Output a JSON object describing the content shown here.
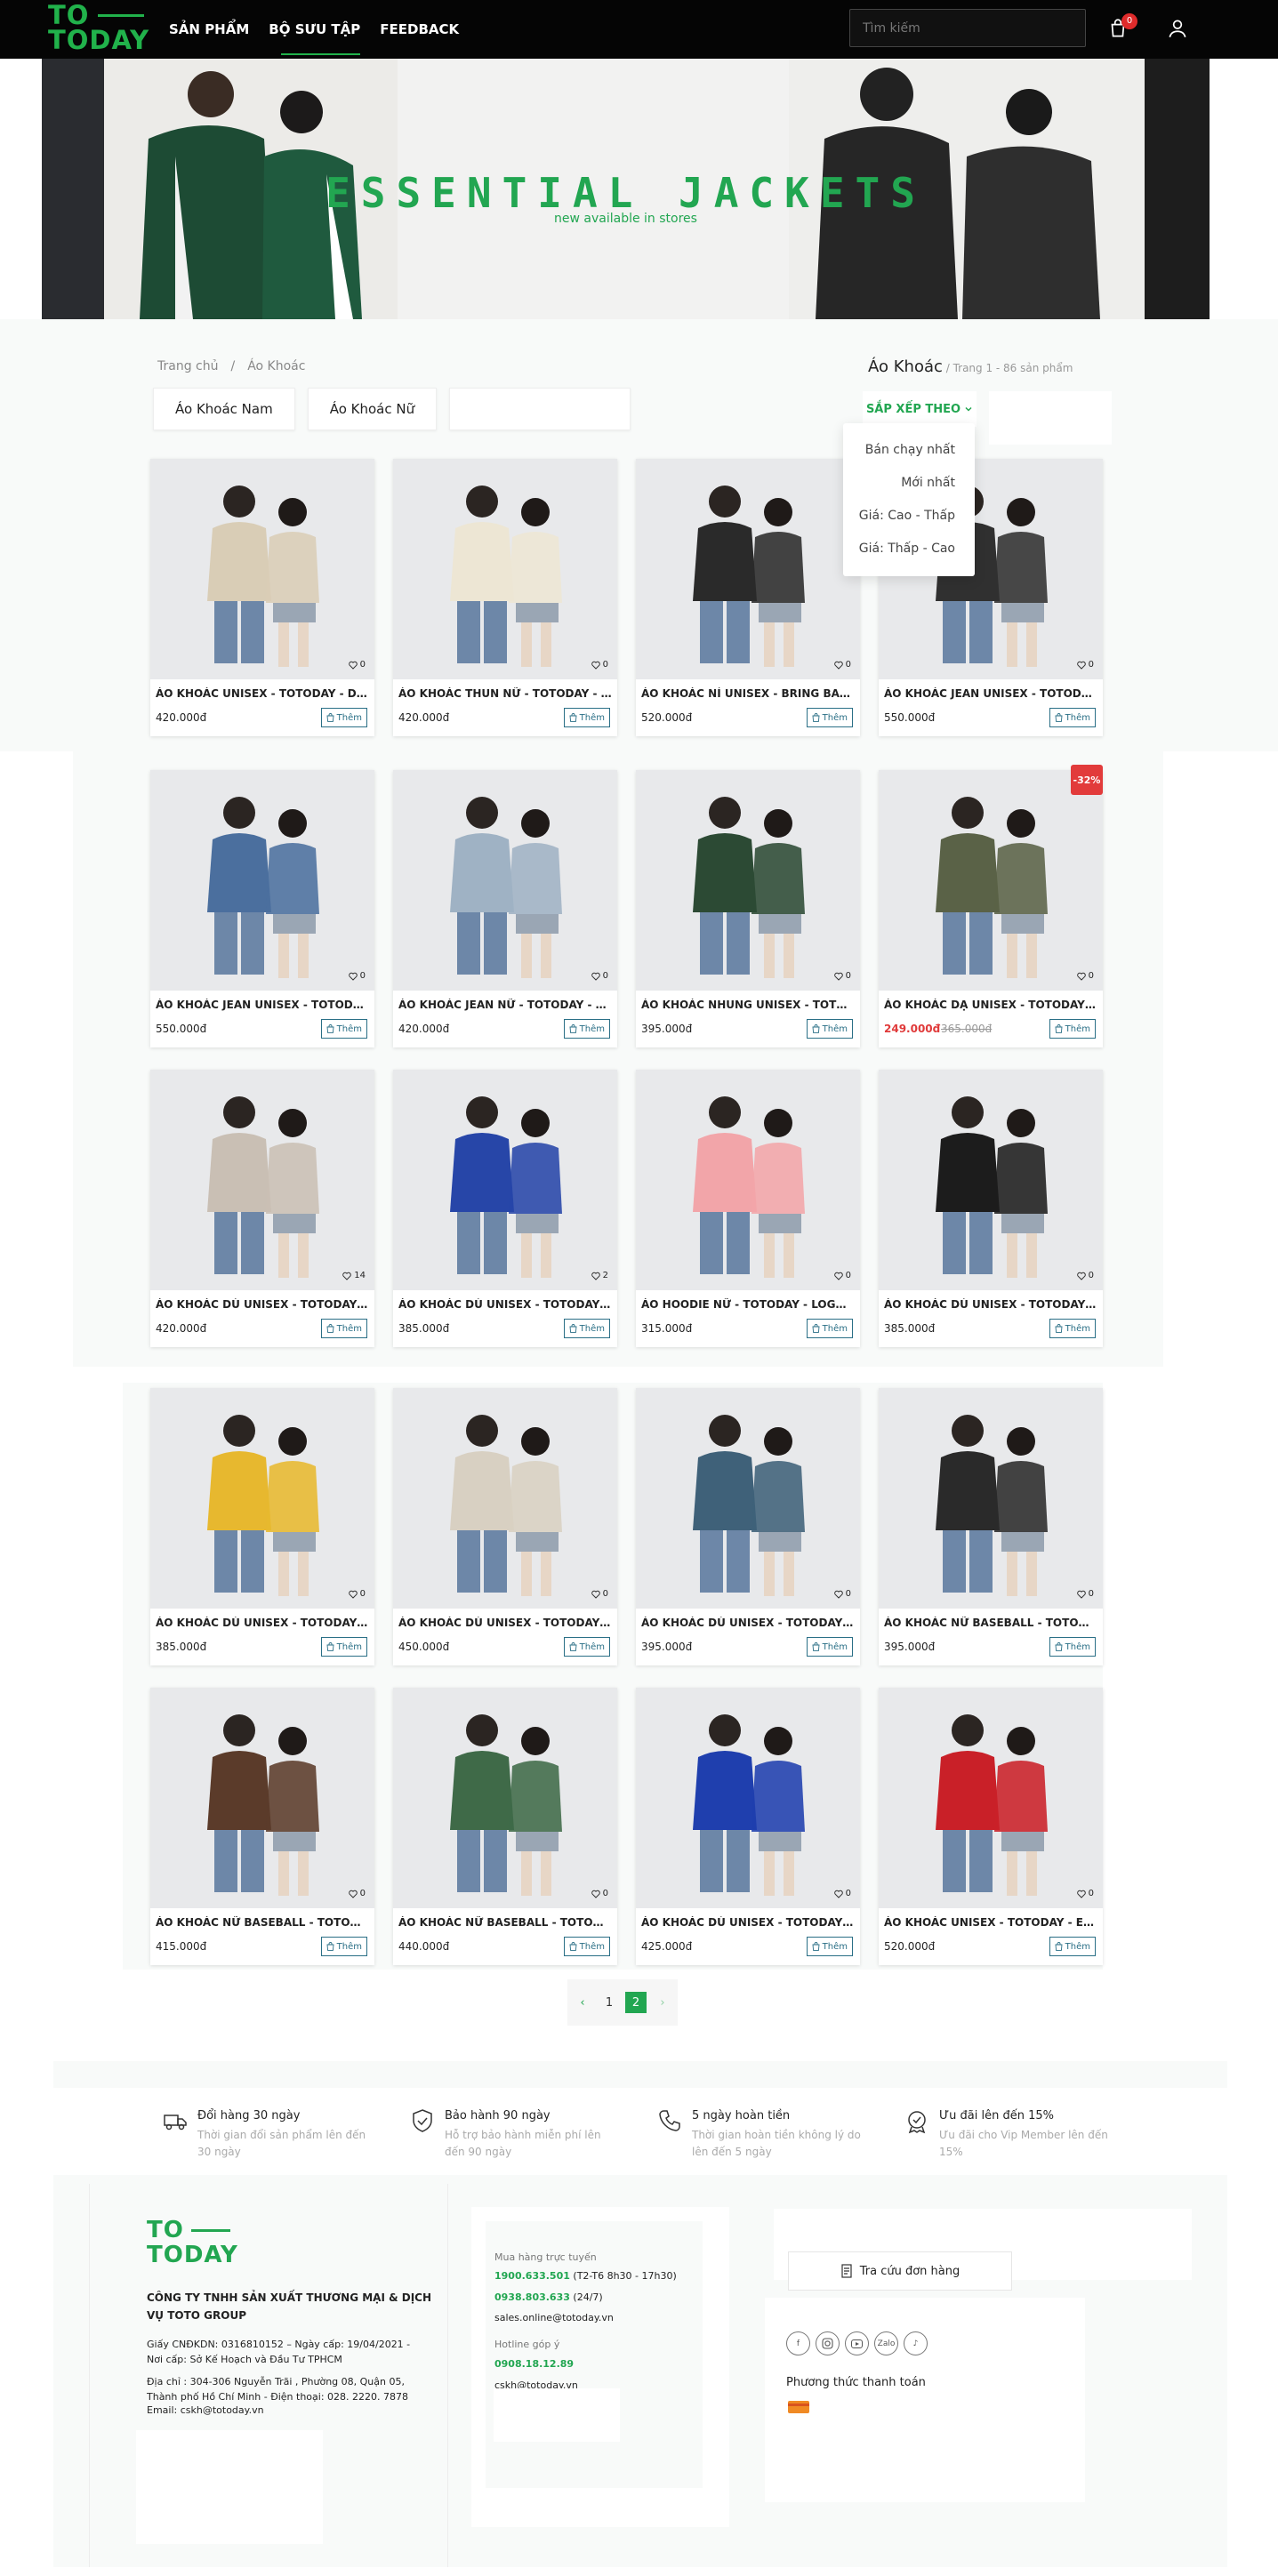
{
  "header": {
    "logo_line1": "TO",
    "logo_line2": "TODAY",
    "nav": [
      "SẢN PHẨM",
      "BỘ SƯU TẬP",
      "FEEDBACK"
    ],
    "search_placeholder": "Tìm kiếm",
    "cart_count": "0",
    "brand_color": "#21b24b"
  },
  "banner": {
    "title": "ESSENTIAL JACKETS",
    "subtitle": "new available in stores"
  },
  "breadcrumb": [
    "Trang chủ",
    "/",
    "Áo Khoác"
  ],
  "category": {
    "title": "Áo Khoác",
    "meta": " / Trang 1 - 86 sản phẩm"
  },
  "filters": [
    "Áo Khoác Nam",
    "Áo Khoác Nữ"
  ],
  "sort": {
    "label": "SẮP XẾP THEO",
    "options": [
      "Bán chạy nhất",
      "Mới nhất",
      "Giá: Cao - Thấp",
      "Giá: Thấp - Cao"
    ]
  },
  "add_label": "Thêm",
  "products": [
    {
      "name": "ÁO KHOÁC UNISEX - TOTODAY - DIFFERENT",
      "price": "420.000đ",
      "likes": "0",
      "color": "#d9cdb6"
    },
    {
      "name": "ÁO KHOÁC THUN NỮ - TOTODAY - DELI",
      "price": "420.000đ",
      "likes": "0",
      "color": "#ede6d4"
    },
    {
      "name": "ÁO KHOÁC NỈ UNISEX - BRING BACK TO",
      "price": "520.000đ",
      "likes": "0",
      "color": "#2a2a2a"
    },
    {
      "name": "ÁO KHOÁC JEAN UNISEX - TOTODAY - BLACK",
      "price": "550.000đ",
      "likes": "0",
      "color": "#303030"
    },
    {
      "name": "ÁO KHOÁC JEAN UNISEX - TOTODAY - BLUE",
      "price": "550.000đ",
      "likes": "0",
      "color": "#4b6f9e"
    },
    {
      "name": "ÁO KHOÁC JEAN NỮ - TOTODAY - DENIM",
      "price": "420.000đ",
      "likes": "0",
      "color": "#9fb2c4"
    },
    {
      "name": "ÁO KHOÁC NHUNG UNISEX - TOTODAY - GREEN",
      "price": "395.000đ",
      "likes": "0",
      "color": "#2c4a34"
    },
    {
      "name": "ÁO KHOÁC DẠ UNISEX - TOTODAY - CHECK",
      "price": "249.000đ",
      "old_price": "365.000đ",
      "discount": "-32%",
      "likes": "0",
      "color": "#5a6247"
    },
    {
      "name": "ÁO KHOÁC DÙ UNISEX - TOTODAY - DIVERSE",
      "price": "420.000đ",
      "likes": "14",
      "color": "#c9bfb4"
    },
    {
      "name": "ÁO KHOÁC DÙ UNISEX - TOTODAY - ACTIVE",
      "price": "385.000đ",
      "likes": "2",
      "color": "#2746a8"
    },
    {
      "name": "ÁO HOODIE NỮ - TOTODAY - LOGO C",
      "price": "315.000đ",
      "likes": "0",
      "color": "#f2a5a9"
    },
    {
      "name": "ÁO KHOÁC DÙ UNISEX - TOTODAY - ALL BLACK",
      "price": "385.000đ",
      "likes": "0",
      "color": "#1c1c1c"
    },
    {
      "name": "ÁO KHOÁC DÙ UNISEX - TOTODAY - SPORT",
      "price": "385.000đ",
      "likes": "0",
      "color": "#e7b82f"
    },
    {
      "name": "ÁO KHOÁC DÙ UNISEX - TOTODAY - GLORY",
      "price": "450.000đ",
      "likes": "0",
      "color": "#d8d0c2"
    },
    {
      "name": "ÁO KHOÁC DÙ UNISEX - TOTODAY - RETRO",
      "price": "395.000đ",
      "likes": "0",
      "color": "#3f6179"
    },
    {
      "name": "ÁO KHOÁC NỮ BASEBALL - TOTODAY - BLACK",
      "price": "395.000đ",
      "likes": "0",
      "color": "#2a2a2a"
    },
    {
      "name": "ÁO KHOÁC NỮ BASEBALL - TOTODAY - BROWN",
      "price": "415.000đ",
      "likes": "0",
      "color": "#5b3b2a"
    },
    {
      "name": "ÁO KHOÁC NỮ BASEBALL - TOTODAY - GREEN",
      "price": "440.000đ",
      "likes": "0",
      "color": "#3f6a48"
    },
    {
      "name": "ÁO KHOÁC DÙ UNISEX - TOTODAY - REVERSE",
      "price": "425.000đ",
      "likes": "0",
      "color": "#1f3fae"
    },
    {
      "name": "ÁO KHOÁC UNISEX - TOTODAY - ENOUGH",
      "price": "520.000đ",
      "likes": "0",
      "color": "#c92028"
    }
  ],
  "pagination": {
    "prev": "‹",
    "pages": [
      "1",
      "2"
    ],
    "active": "2",
    "next": "›"
  },
  "services": [
    {
      "icon": "truck-icon",
      "title": "Đổi hàng 30 ngày",
      "desc": "Thời gian đổi sản phẩm lên đến 30 ngày"
    },
    {
      "icon": "shield-icon",
      "title": "Bảo hành 90 ngày",
      "desc": "Hỗ trợ bảo hành miễn phí lên đến 90 ngày"
    },
    {
      "icon": "phone-icon",
      "title": "5 ngày hoàn tiền",
      "desc": "Thời gian hoàn tiền không lý do lên đến 5 ngày"
    },
    {
      "icon": "badge-icon",
      "title": "Ưu đãi lên đến 15%",
      "desc": "Ưu đãi cho Vip Member lên đến 15%"
    }
  ],
  "footer": {
    "logo_line1": "TO",
    "logo_line2": "TODAY",
    "company": "CÔNG TY TNHH SẢN XUẤT THƯƠNG MẠI & DỊCH VỤ TOTO GROUP",
    "legal": "Giấy CNĐKDN: 0316810152 – Ngày cấp: 19/04/2021 - Nơi cấp: Sở Kế Hoạch và Đầu Tư TPHCM",
    "address": "Địa chỉ : 304-306 Nguyễn Trãi , Phường 08, Quận 05, Thành phố Hồ Chí Minh - Điện thoại: 028. 2220. 7878",
    "email": "Email: cskh@totoday.vn",
    "online_label": "Mua hàng trực tuyến",
    "online_phone": "1900.633.501",
    "online_hours": " (T2-T6 8h30 - 17h30)",
    "phone2": "0938.803.633",
    "phone2_note": " (24/7)",
    "sales_email": "sales.online@totoday.vn",
    "hotline_label": "Hotline góp ý",
    "hotline": "0908.18.12.89",
    "cskh_email": "cskh@totoday.vn",
    "track_label": "Tra cứu đơn hàng",
    "socials": [
      "facebook-icon",
      "instagram-icon",
      "youtube-icon",
      "zalo-icon",
      "tiktok-icon"
    ],
    "zalo_text": "Zalo",
    "payment_title": "Phương thức thanh toán"
  }
}
